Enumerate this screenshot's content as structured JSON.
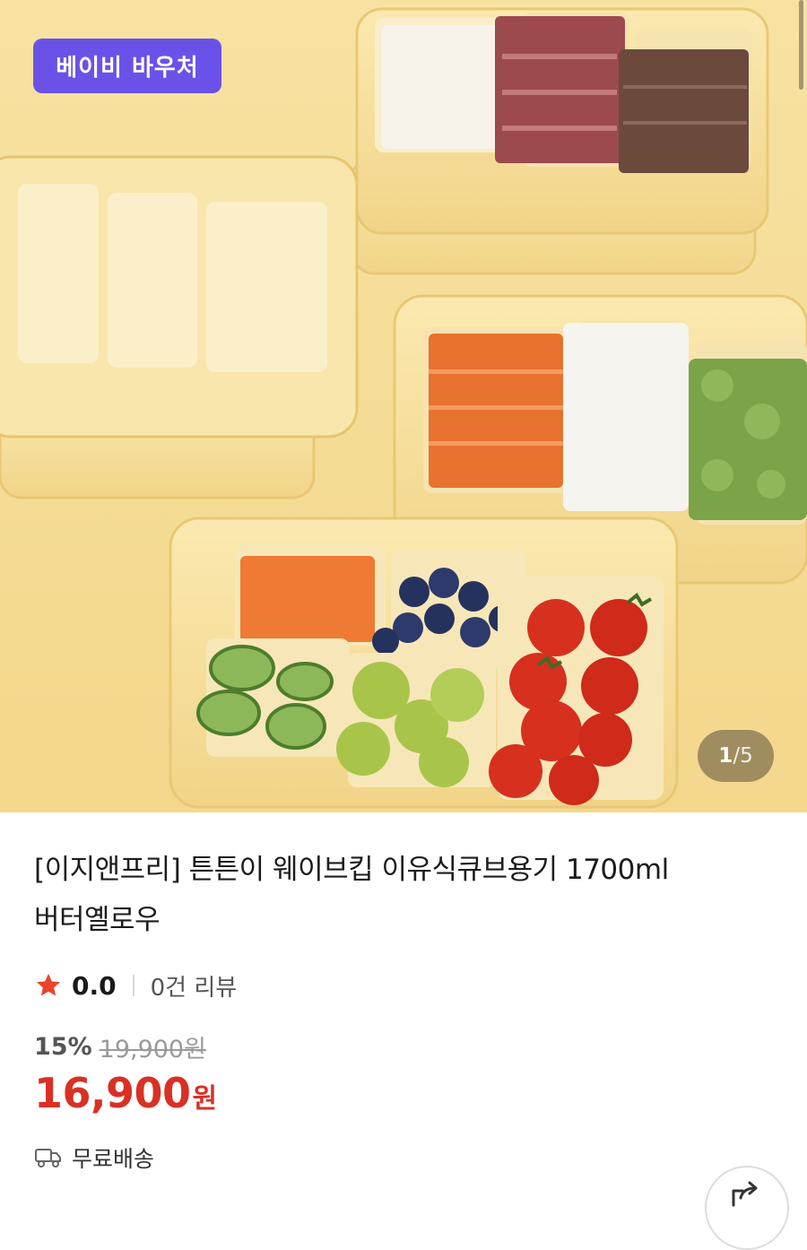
{
  "hero": {
    "image_alt": "product-photo-baby-food-cube-containers",
    "voucher_badge": "베이비 바우처",
    "counter": {
      "current": "1",
      "separator": "/",
      "total": "5"
    }
  },
  "product": {
    "title_line1": "[이지앤프리] 튼튼이 웨이브킵 이유식큐브용기 1700ml",
    "title_line2": "버터옐로우"
  },
  "rating": {
    "score": "0.0",
    "reviews": "0건 리뷰"
  },
  "price": {
    "discount": "15%",
    "original": "19,900원",
    "current": "16,900",
    "unit": "원"
  },
  "shipping": {
    "label": "무료배송"
  },
  "icons": {
    "star": "star-icon",
    "truck": "truck-icon",
    "share": "share-icon"
  },
  "colors": {
    "voucher_bg": "#6a52e8",
    "price_red": "#d93025",
    "hero_bg": "#f5dc95"
  }
}
